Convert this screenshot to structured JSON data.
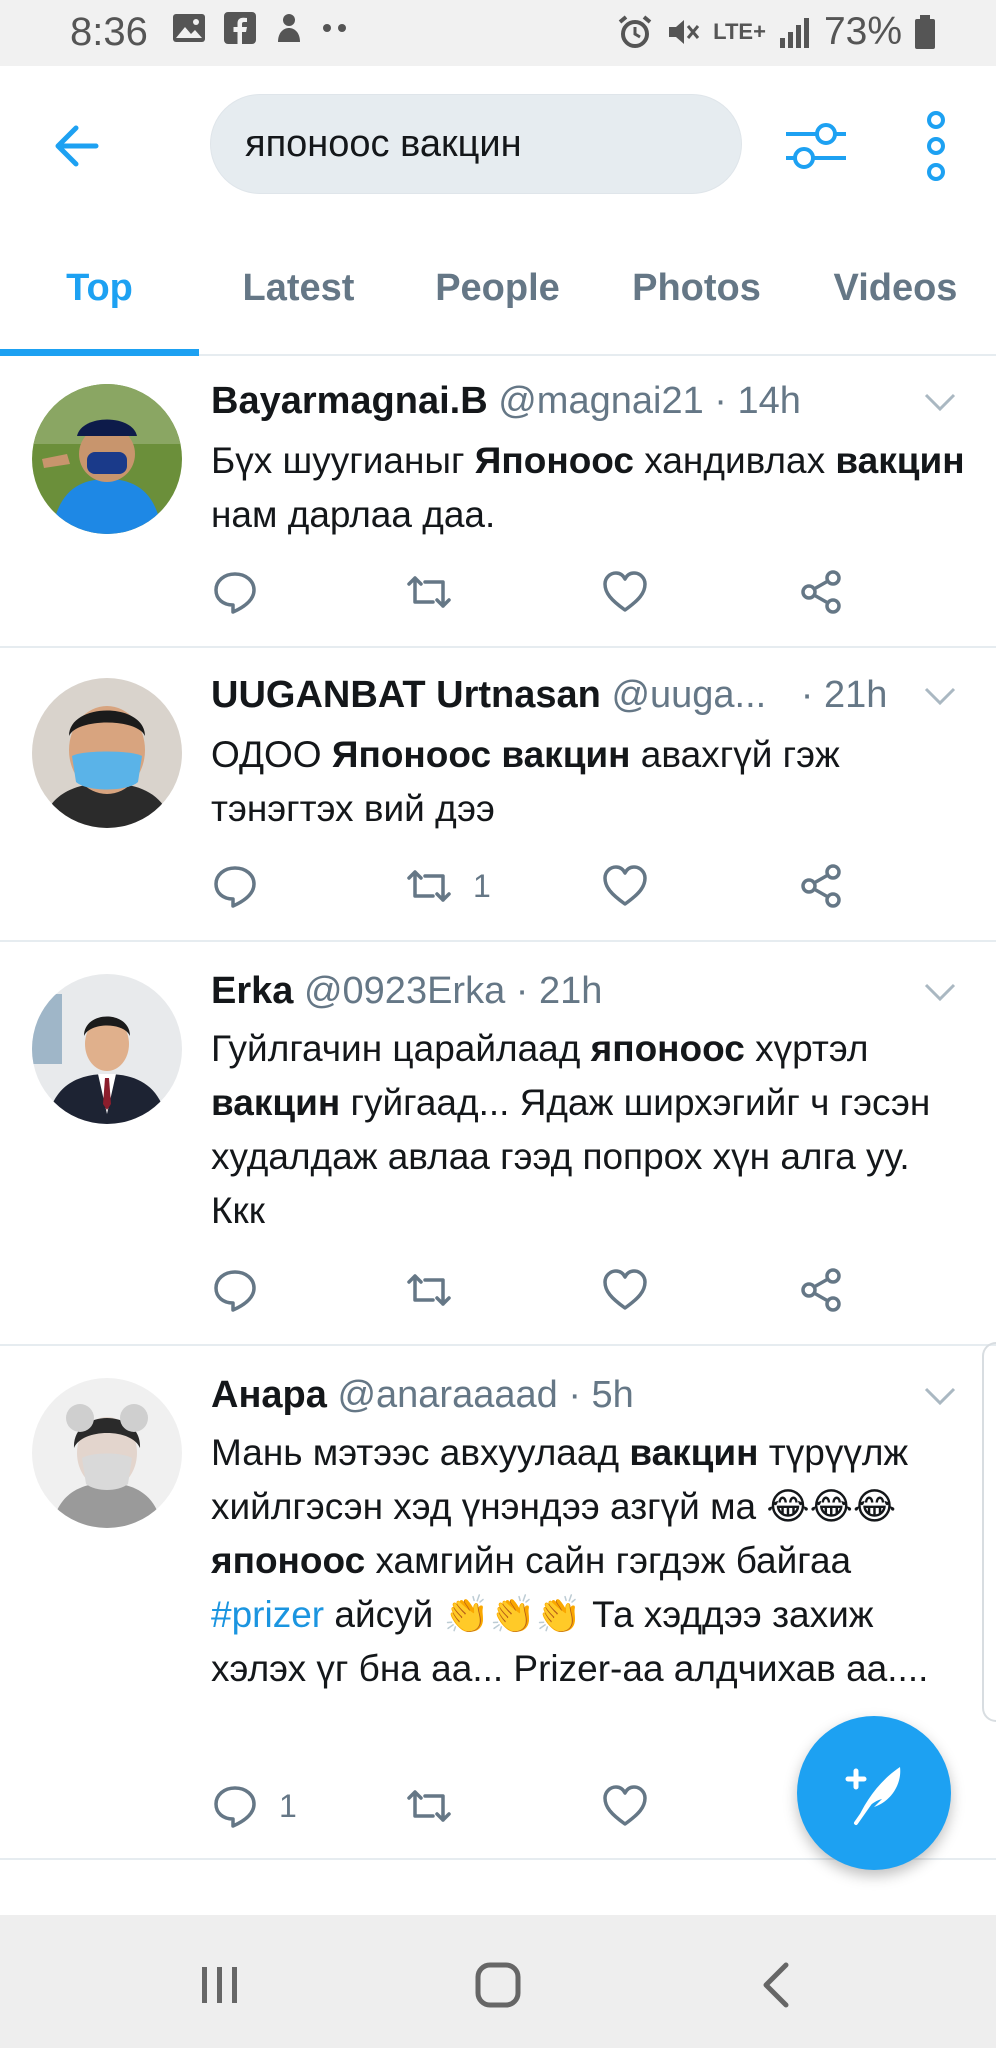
{
  "status_bar": {
    "time": "8:36",
    "network": "LTE+",
    "battery": "73%",
    "notif_icons": [
      "image-icon",
      "facebook-icon",
      "app-icon",
      "more-dots-icon"
    ]
  },
  "search": {
    "query": "японоос вакцин"
  },
  "tabs": [
    {
      "label": "Top",
      "active": true
    },
    {
      "label": "Latest"
    },
    {
      "label": "People"
    },
    {
      "label": "Photos"
    },
    {
      "label": "Videos"
    }
  ],
  "tweets": [
    {
      "name": "Bayarmagnai.B",
      "handle": "@magnai21",
      "sep": "·",
      "time": "14h",
      "text_parts": [
        "Бүх шуугианыг ",
        "Японоос",
        " хандивлах ",
        "вакцин",
        " нам дарлаа даа."
      ],
      "retweets": "",
      "replies": ""
    },
    {
      "name": "UUGANBAT Urtnasan",
      "handle": "@uuga...",
      "sep": "·",
      "time": "21h",
      "text_parts": [
        "ОДОО ",
        "Японоос вакцин",
        " авахгүй гэж тэнэгтэх вий дээ"
      ],
      "retweets": "1",
      "replies": ""
    },
    {
      "name": "Erka",
      "handle": "@0923Erka",
      "sep": "·",
      "time": "21h",
      "text_parts": [
        "Гуйлгачин царайлаад ",
        "японоос",
        " хүртэл ",
        "вакцин",
        " гуйгаад...  Ядаж ширхэгийг ч гэсэн худалдаж авлаа гээд попрох хүн алга уу. Ккк"
      ],
      "retweets": "",
      "replies": ""
    },
    {
      "name": "Анара",
      "handle": "@anaraaaad",
      "sep": "·",
      "time": "5h",
      "text_parts": [
        "Мань мэтээс авхуулаад ",
        "вакцин",
        " түрүүлж хийлгэсэн хэд үнэндээ азгүй ма 😂😂😂 ",
        "японоос",
        " хамгийн сайн гэгдэж байгаа ",
        "#prizer",
        " айсуй 👏👏👏 Та хэддээ захиж хэлэх үг бна аа... Prizer-аа алдчихав аа...."
      ],
      "retweets": "",
      "replies": "1"
    }
  ],
  "colors": {
    "accent": "#1da1f2",
    "secondary_text": "#657786",
    "divider": "#e6ecf0"
  }
}
